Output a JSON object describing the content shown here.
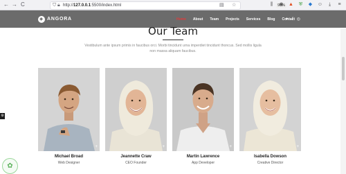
{
  "browser": {
    "back_glyph": "←",
    "forward_glyph": "→",
    "reload_glyph": "C",
    "url_prefix": "http://",
    "url_host": "127.0.0.1",
    "url_rest": ":5500/index.html",
    "zoom": "90%",
    "icons": [
      "shield-icon",
      "lock-icon",
      "bookmark-icon",
      "reader-icon",
      "menu-icon",
      "extension-icon",
      "profile-icon"
    ]
  },
  "header": {
    "brand": "ANGORA",
    "menu": [
      "Home",
      "About",
      "Team",
      "Projects",
      "Services",
      "Blog",
      "Contact"
    ],
    "active_item": "Home",
    "social": [
      "twitter-icon",
      "facebook-icon",
      "instagram-icon"
    ],
    "colors": {
      "header_bg": "#6b6b6b",
      "active": "#e23a3a"
    }
  },
  "section": {
    "title": "Our Team",
    "intro": "Vestibulum ante ipsum primis in faucibus orci. Morbi tincidunt urna imperdiet tincidunt thoncus. Sed mollis ligula non massa aliquam faucibus."
  },
  "team": [
    {
      "name": "Michael Broad",
      "role": "Web Designer"
    },
    {
      "name": "Jeannette Craw",
      "role": "CEO Founder"
    },
    {
      "name": "Martin Lawrence",
      "role": "App Developer"
    },
    {
      "name": "Isabella Dowson",
      "role": "Creative Director"
    }
  ]
}
